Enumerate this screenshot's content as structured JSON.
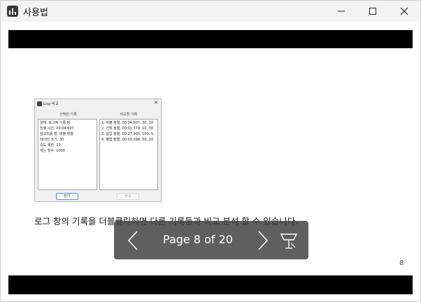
{
  "window": {
    "title": "사용법"
  },
  "slide": {
    "screenshot": {
      "title": "Log 비교",
      "left_header": "선택한 기록",
      "right_header": "비교할 기록",
      "left_lines": [
        "상태: 로그에 기록 됨",
        "진행 시간: 00:04.607",
        "알고리즘 명: 버블 정렬",
        "데이터 크기: 30",
        "속도 제한: 10",
        "섞는 횟수: 1000"
      ],
      "right_lines": [
        "1. 버블 정렬, 00:04.607, 30, 10",
        "2. 선택 정렬, 00:01.379, 10, 30",
        "3. 삽입 정렬, 00:27.905, 100, 5",
        "4. 병합 정렬, 00:03.098, 50, 10"
      ],
      "button_left": "닫기",
      "button_right": "비교"
    },
    "caption": "로그 창의 기록을 더블클릭하면 다른 기록들과 비교 분석 할 수 있습니다.",
    "page_number": "8"
  },
  "overlay": {
    "page_label": "Page 8 of 20"
  },
  "colors": {
    "overlay_bg": "#3c3c3c",
    "bars": "#000000"
  }
}
